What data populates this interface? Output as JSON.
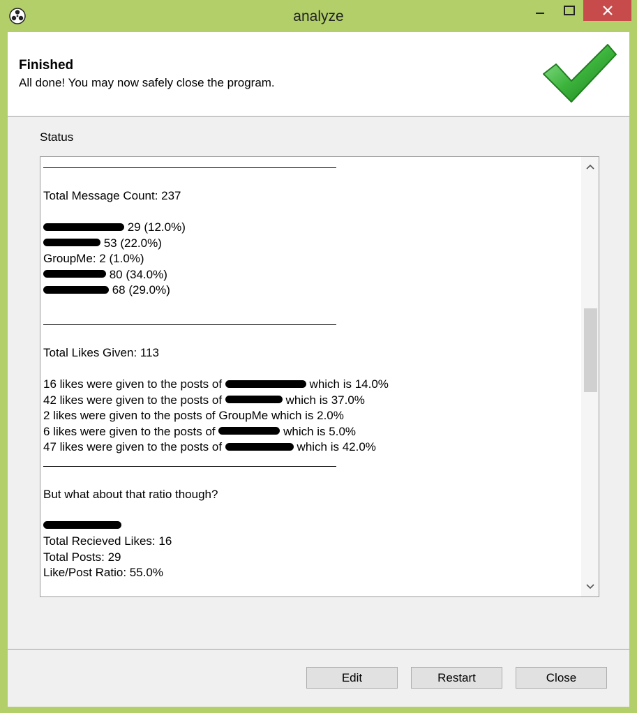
{
  "window": {
    "title": "analyze"
  },
  "header": {
    "title": "Finished",
    "subtitle": "All done! You may now safely close the program."
  },
  "status": {
    "label": "Status",
    "lines": [
      {
        "type": "sep"
      },
      {
        "type": "blank"
      },
      {
        "type": "text",
        "text": "Total Message Count: 237"
      },
      {
        "type": "blank"
      },
      {
        "type": "redacted",
        "redact_w": 116,
        "after": " 29 (12.0%)"
      },
      {
        "type": "redacted",
        "redact_w": 82,
        "after": " 53 (22.0%)"
      },
      {
        "type": "text",
        "text": "GroupMe: 2 (1.0%)"
      },
      {
        "type": "redacted",
        "redact_w": 90,
        "after": " 80 (34.0%)"
      },
      {
        "type": "redacted",
        "redact_w": 94,
        "after": " 68 (29.0%)"
      },
      {
        "type": "blank"
      },
      {
        "type": "sep"
      },
      {
        "type": "blank"
      },
      {
        "type": "text",
        "text": "Total Likes Given: 113"
      },
      {
        "type": "blank"
      },
      {
        "type": "mixed",
        "before": "16 likes were given to the posts of ",
        "redact_w": 116,
        "after": " which is 14.0%"
      },
      {
        "type": "mixed",
        "before": "42 likes were given to the posts of ",
        "redact_w": 82,
        "after": " which is 37.0%"
      },
      {
        "type": "text",
        "text": "2 likes were given to the posts of GroupMe which is 2.0%"
      },
      {
        "type": "mixed",
        "before": "6 likes were given to the posts of ",
        "redact_w": 88,
        "after": " which is 5.0%"
      },
      {
        "type": "mixed",
        "before": "47 likes were given to the posts of ",
        "redact_w": 98,
        "after": " which is 42.0%"
      },
      {
        "type": "sep"
      },
      {
        "type": "blank"
      },
      {
        "type": "text",
        "text": "But what about that ratio though?"
      },
      {
        "type": "blank"
      },
      {
        "type": "redacted",
        "redact_w": 112,
        "after": ""
      },
      {
        "type": "text",
        "text": "Total Recieved Likes: 16"
      },
      {
        "type": "text",
        "text": "Total Posts: 29"
      },
      {
        "type": "text",
        "text": "Like/Post Ratio: 55.0%"
      },
      {
        "type": "blank"
      },
      {
        "type": "redacted",
        "redact_w": 80,
        "after": ""
      }
    ]
  },
  "buttons": {
    "edit": "Edit",
    "restart": "Restart",
    "close": "Close"
  },
  "colors": {
    "frame": "#b2cf6a",
    "close_button": "#c74b4b",
    "check_green": "#3cb43c"
  }
}
